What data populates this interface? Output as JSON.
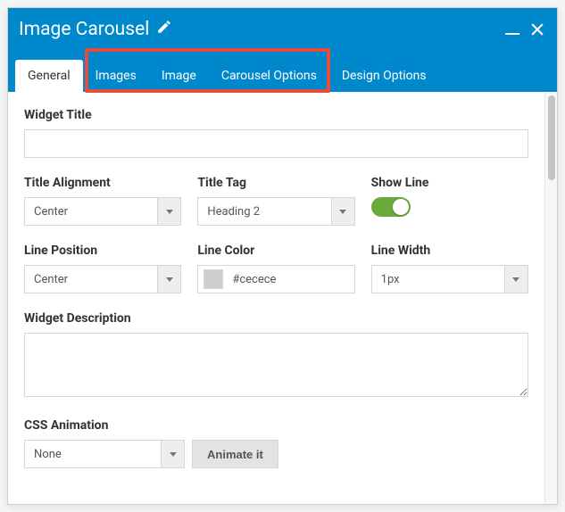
{
  "title": "Image Carousel",
  "tabs": [
    {
      "label": "General",
      "active": true
    },
    {
      "label": "Images",
      "active": false
    },
    {
      "label": "Image",
      "active": false
    },
    {
      "label": "Carousel Options",
      "active": false
    },
    {
      "label": "Design Options",
      "active": false
    }
  ],
  "fields": {
    "widget_title": {
      "label": "Widget Title",
      "value": ""
    },
    "title_alignment": {
      "label": "Title Alignment",
      "value": "Center"
    },
    "title_tag": {
      "label": "Title Tag",
      "value": "Heading 2"
    },
    "show_line": {
      "label": "Show Line",
      "on": true
    },
    "line_position": {
      "label": "Line Position",
      "value": "Center"
    },
    "line_color": {
      "label": "Line Color",
      "hex": "#cecece"
    },
    "line_width": {
      "label": "Line Width",
      "value": "1px"
    },
    "widget_description": {
      "label": "Widget Description",
      "value": ""
    },
    "css_animation": {
      "label": "CSS Animation",
      "value": "None",
      "button": "Animate it"
    }
  }
}
